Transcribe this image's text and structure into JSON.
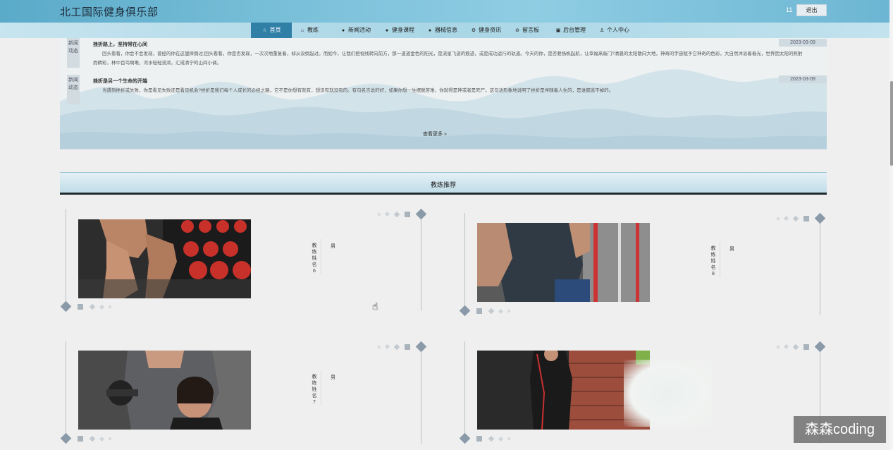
{
  "header": {
    "site_title": "北工国际健身俱乐部",
    "user_number": "11",
    "logout_label": "退出",
    "colors": {
      "header_bg": "#7cc1da",
      "nav_active": "#2f7fa6"
    }
  },
  "nav": {
    "items": [
      {
        "label": "首页",
        "icon": "star-icon"
      },
      {
        "label": "教练",
        "icon": "bag-icon"
      },
      {
        "label": "新闻活动",
        "icon": "info-icon"
      },
      {
        "label": "健身课程",
        "icon": "question-icon"
      },
      {
        "label": "器械信息",
        "icon": "info-icon"
      },
      {
        "label": "健身资讯",
        "icon": "gear-icon"
      },
      {
        "label": "留言板",
        "icon": "check-circle-icon"
      },
      {
        "label": "后台管理",
        "icon": "calendar-icon"
      },
      {
        "label": "个人中心",
        "icon": "user-icon"
      }
    ]
  },
  "news": {
    "items": [
      {
        "tag": "新闻动态",
        "title": "挫折路上，坚持常在心间",
        "date": "2023-03-09",
        "text": "回头看看，你会不会发现，曾经的你在这里摔倒过;回头看看，你是否发现，一次次地重复着，却从没倒起过。而如今，让我们把视线转向前方，那一道道金色的阳光，是流星飞逝的痕迹，或是成功运行的轨道。今天的你，是否要扬帆起航，让幸福来敲门?清晨的太阳散向大地，神奇的宇宙赋予它神奇的色彩，大自然沐浴着春光，世界因太阳的照射而精彩，林中百鸟啁啾，河水轻轻流淌，汇成清宁的山间小调。"
      },
      {
        "tag": "新闻动态",
        "title": "挫折是另一个生命的开端",
        "date": "2023-03-09",
        "text": "当遇到挫折或失败，你是看见失败还是看见机会?挫折是我们每个人成长的必经之路，它不是你想有就有，想没有就没有的。有句名言说的好，如果你想一生摆脱苦难，你就得是神或者是死尸。这句话形象地说明了挫折是伴随着人生的，是谁都逃不掉的。"
      }
    ],
    "view_more": "查看更多 »"
  },
  "coach_section": {
    "title": "教练推荐"
  },
  "coaches": [
    {
      "name": "教练姓名6",
      "gender": "男"
    },
    {
      "name": "教练姓名8",
      "gender": "男"
    },
    {
      "name": "教练姓名7",
      "gender": "男"
    },
    {
      "name": "",
      "gender": ""
    }
  ],
  "watermark": "森森coding"
}
